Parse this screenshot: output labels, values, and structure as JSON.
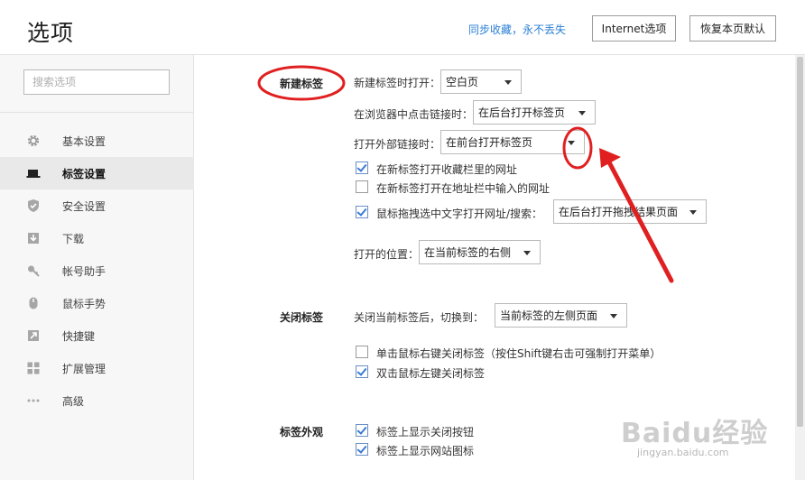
{
  "header": {
    "title": "选项",
    "sync_link": "同步收藏，永不丢失",
    "internet_button": "Internet选项",
    "restore_button": "恢复本页默认"
  },
  "sidebar": {
    "search_placeholder": "搜索选项",
    "items": [
      {
        "label": "基本设置",
        "icon": "gear-icon",
        "active": false
      },
      {
        "label": "标签设置",
        "icon": "tab-icon",
        "active": true
      },
      {
        "label": "安全设置",
        "icon": "shield-icon",
        "active": false
      },
      {
        "label": "下载",
        "icon": "download-icon",
        "active": false
      },
      {
        "label": "帐号助手",
        "icon": "key-icon",
        "active": false
      },
      {
        "label": "鼠标手势",
        "icon": "mouse-icon",
        "active": false
      },
      {
        "label": "快捷键",
        "icon": "arrow-icon",
        "active": false
      },
      {
        "label": "扩展管理",
        "icon": "grid-icon",
        "active": false
      },
      {
        "label": "高级",
        "icon": "more-icon",
        "active": false
      }
    ]
  },
  "new_tab": {
    "section_title": "新建标签",
    "open_new_tab_label": "新建标签时打开：",
    "open_new_tab_value": "空白页",
    "click_link_label": "在浏览器中点击链接时：",
    "click_link_value": "在后台打开标签页",
    "external_link_label": "打开外部链接时：",
    "external_link_value": "在前台打开标签页",
    "cb_favorites": {
      "label": "在新标签打开收藏栏里的网址",
      "checked": true
    },
    "cb_addressbar": {
      "label": "在新标签打开在地址栏中输入的网址",
      "checked": false
    },
    "cb_drag": {
      "label": "鼠标拖拽选中文字打开网址/搜索：",
      "checked": true
    },
    "drag_value": "在后台打开拖拽结果页面",
    "position_label": "打开的位置：",
    "position_value": "在当前标签的右侧"
  },
  "close_tab": {
    "section_title": "关闭标签",
    "after_close_label": "关闭当前标签后，切换到：",
    "after_close_value": "当前标签的左侧页面",
    "cb_right_click": {
      "label": "单击鼠标右键关闭标签（按住Shift键右击可强制打开菜单）",
      "checked": false
    },
    "cb_double_click": {
      "label": "双击鼠标左键关闭标签",
      "checked": true
    }
  },
  "tab_appearance": {
    "section_title": "标签外观",
    "cb_close_button": {
      "label": "标签上显示关闭按钮",
      "checked": true
    },
    "cb_site_icon": {
      "label": "标签上显示网站图标",
      "checked": true
    }
  },
  "watermark": {
    "main": "Baidu经验",
    "sub": "jingyan.baidu.com"
  },
  "colors": {
    "accent": "#2a7fd5",
    "annotation": "#e02020",
    "sidebar_bg": "#f7f7f7",
    "active_item_bg": "#e9e9e9"
  }
}
